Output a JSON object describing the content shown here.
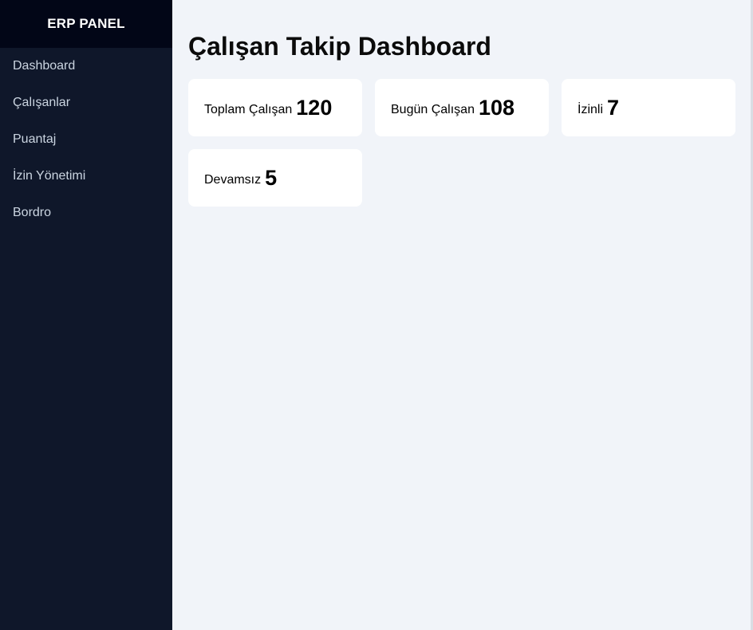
{
  "sidebar": {
    "title": "ERP PANEL",
    "items": [
      {
        "label": "Dashboard"
      },
      {
        "label": "Çalışanlar"
      },
      {
        "label": "Puantaj"
      },
      {
        "label": "İzin Yönetimi"
      },
      {
        "label": "Bordro"
      }
    ]
  },
  "main": {
    "title": "Çalışan Takip Dashboard",
    "cards": [
      {
        "label": "Toplam Çalışan",
        "value": "120"
      },
      {
        "label": "Bugün Çalışan",
        "value": "108"
      },
      {
        "label": "İzinli",
        "value": "7"
      },
      {
        "label": "Devamsız",
        "value": "5"
      }
    ]
  },
  "colors": {
    "sidebar_bg": "#0f172a",
    "sidebar_header_bg": "#020617",
    "main_bg": "#f1f4f9",
    "card_bg": "#ffffff"
  }
}
